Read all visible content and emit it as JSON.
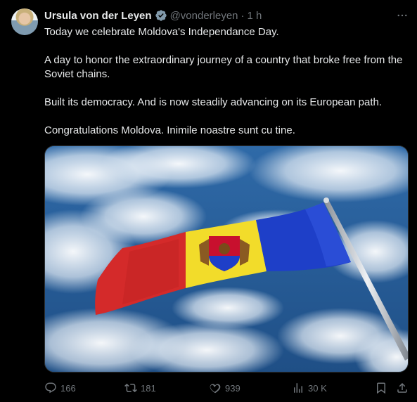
{
  "tweet": {
    "author_name": "Ursula von der Leyen",
    "handle": "@vonderleyen",
    "separator": "·",
    "time": "1 h",
    "paragraphs": [
      "Today we celebrate Moldova's Independance Day.",
      "A day to honor the extraordinary journey of a country that broke free from the Soviet chains.",
      "Built its democracy. And is now steadily advancing on its European path.",
      "Congratulations Moldova. Inimile noastre sunt cu tine."
    ]
  },
  "actions": {
    "replies": "166",
    "reposts": "181",
    "likes": "939",
    "views": "30 K"
  },
  "colors": {
    "background": "#000000",
    "text": "#e7e9ea",
    "muted": "#71767b",
    "verified": "#829aab",
    "flag_blue": "#1e3fc8",
    "flag_yellow": "#f2dc2a",
    "flag_red": "#d42a2a"
  },
  "icons": [
    "verified-badge-icon",
    "more-icon",
    "reply-icon",
    "repost-icon",
    "like-icon",
    "views-icon",
    "bookmark-icon",
    "share-icon"
  ]
}
